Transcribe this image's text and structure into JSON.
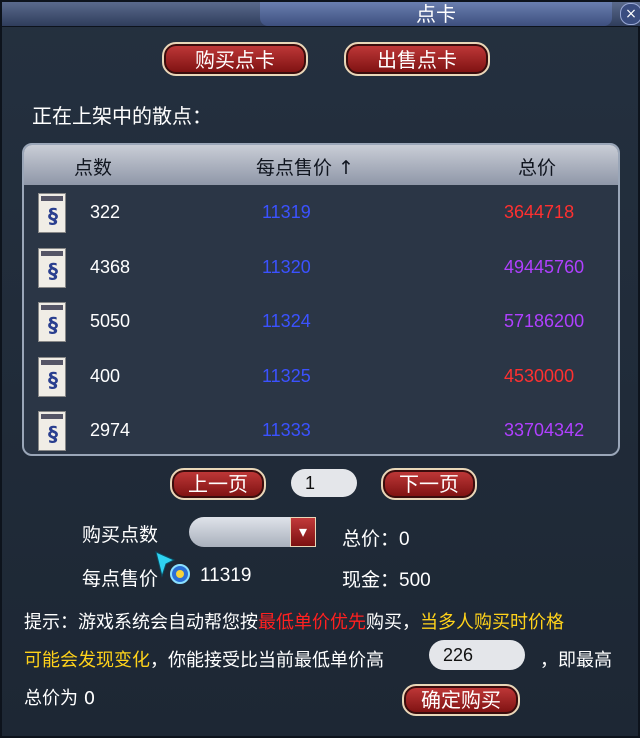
{
  "window": {
    "title": "点卡",
    "close_glyph": "×"
  },
  "buttons": {
    "buy_card": "购买点卡",
    "sell_card": "出售点卡",
    "prev_page": "上一页",
    "next_page": "下一页",
    "confirm": "确定购买"
  },
  "section_label": "正在上架中的散点：",
  "table": {
    "headers": {
      "points": "点数",
      "unit_price": "每点售价",
      "total": "总价"
    },
    "sort_indicator": "↑",
    "rows": [
      {
        "points": "322",
        "unit_price": "11319",
        "total": "3644718",
        "total_color": "#ff3030"
      },
      {
        "points": "4368",
        "unit_price": "11320",
        "total": "49445760",
        "total_color": "#b040ff"
      },
      {
        "points": "5050",
        "unit_price": "11324",
        "total": "57186200",
        "total_color": "#b040ff"
      },
      {
        "points": "400",
        "unit_price": "11325",
        "total": "4530000",
        "total_color": "#ff3030"
      },
      {
        "points": "2974",
        "unit_price": "11333",
        "total": "33704342",
        "total_color": "#b040ff"
      }
    ]
  },
  "pagination": {
    "page": "1"
  },
  "form": {
    "buy_points_label": "购买点数",
    "buy_points_value": "",
    "total_label": "总价：",
    "total_value": "0",
    "unit_price_label": "每点售价",
    "unit_price_value": "11319",
    "cash_label": "现金：",
    "cash_value": "500"
  },
  "hint": {
    "prefix": "提示：游戏系统会自动帮您按",
    "highlight_red": "最低单价优先",
    "mid": "购买，",
    "highlight_yellow_1": "当多人购买时价格",
    "highlight_yellow_2": "可能会发现变化",
    "line2_rest": "，你能接受比当前最低单价高",
    "max_extra": "226",
    "line2_end": "，即最高",
    "line3": "总价为 0"
  },
  "colors": {
    "price_blue": "#3b52ff",
    "total_red": "#ff3030",
    "total_purple": "#b040ff",
    "hint_red": "#ff2020",
    "hint_yellow": "#ffd21a"
  },
  "icons": {
    "row_item": "point-card-icon",
    "cursor": "magic-wand-cursor-icon"
  }
}
